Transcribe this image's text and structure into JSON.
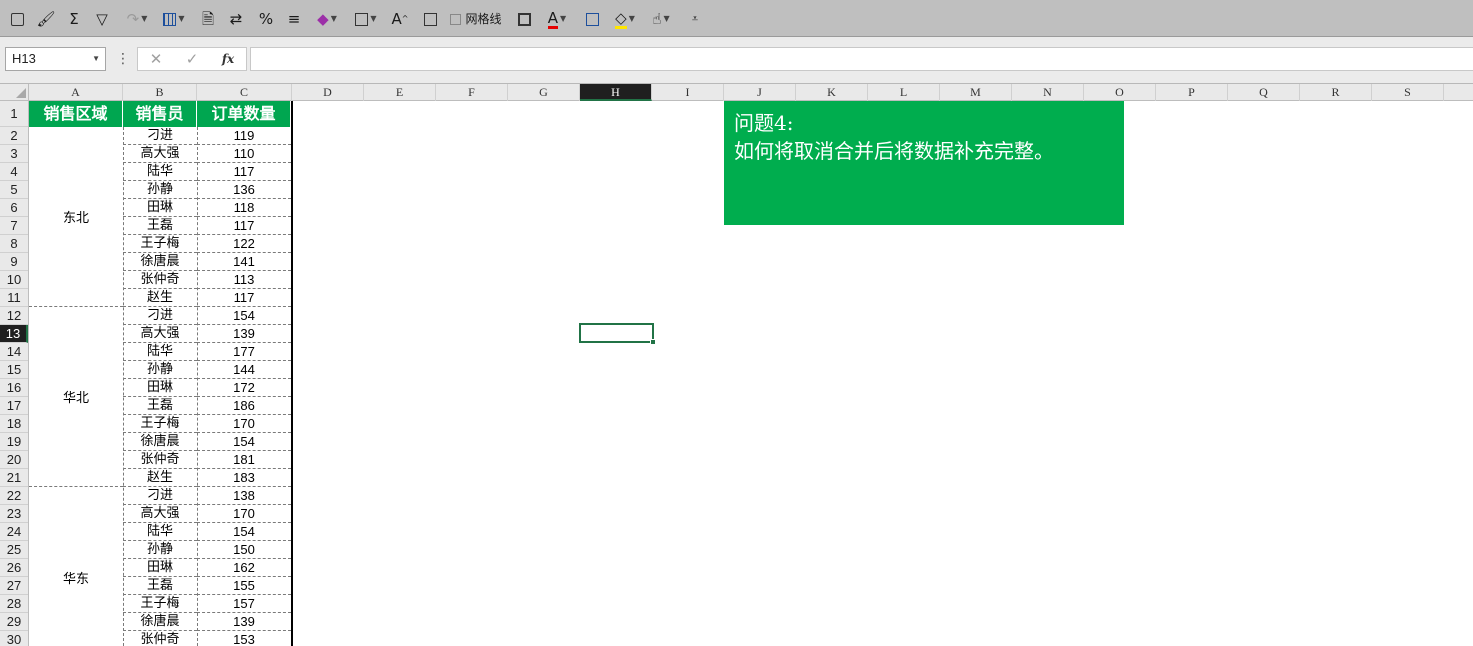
{
  "toolbar": {
    "gridlines_label": "网格线",
    "glyphs": {
      "sum": "Σ",
      "filter": "▽",
      "percent": "%",
      "font_size": "A",
      "font_color": "A"
    },
    "colors": {
      "font_color": "#e60000",
      "fill_color": "#ffe600"
    }
  },
  "formula_bar": {
    "name_box": "H13",
    "separator": "⋮",
    "cancel": "✕",
    "confirm": "✓",
    "fx": "fx",
    "value": ""
  },
  "grid": {
    "columns": [
      "A",
      "B",
      "C",
      "D",
      "E",
      "F",
      "G",
      "H",
      "I",
      "J",
      "K",
      "L",
      "M",
      "N",
      "O",
      "P",
      "Q",
      "R",
      "S"
    ],
    "rows": [
      "1",
      "2",
      "3",
      "4",
      "5",
      "6",
      "7",
      "8",
      "9",
      "10",
      "11",
      "12",
      "13",
      "14",
      "15",
      "16",
      "17",
      "18",
      "19",
      "20",
      "21",
      "22",
      "23",
      "24",
      "25",
      "26",
      "27",
      "28",
      "29",
      "30"
    ],
    "active_column": "H",
    "active_row": "13"
  },
  "sheet": {
    "headers": [
      "销售区域",
      "销售员",
      "订单数量"
    ],
    "regions": [
      "东北",
      "华北",
      "华东"
    ],
    "people": [
      "刁进",
      "高大强",
      "陆华",
      "孙静",
      "田琳",
      "王磊",
      "王子梅",
      "徐唐晨",
      "张仲奇",
      "赵生",
      "刁进",
      "高大强",
      "陆华",
      "孙静",
      "田琳",
      "王磊",
      "王子梅",
      "徐唐晨",
      "张仲奇",
      "赵生",
      "刁进",
      "高大强",
      "陆华",
      "孙静",
      "田琳",
      "王磊",
      "王子梅",
      "徐唐晨",
      "张仲奇"
    ],
    "counts": [
      "119",
      "110",
      "117",
      "136",
      "118",
      "117",
      "122",
      "141",
      "113",
      "117",
      "154",
      "139",
      "177",
      "144",
      "172",
      "186",
      "170",
      "154",
      "181",
      "183",
      "138",
      "170",
      "154",
      "150",
      "162",
      "155",
      "157",
      "139",
      "153"
    ]
  },
  "note": {
    "line1": "问题4:",
    "line2": "如何将取消合并后将数据补充完整。"
  }
}
